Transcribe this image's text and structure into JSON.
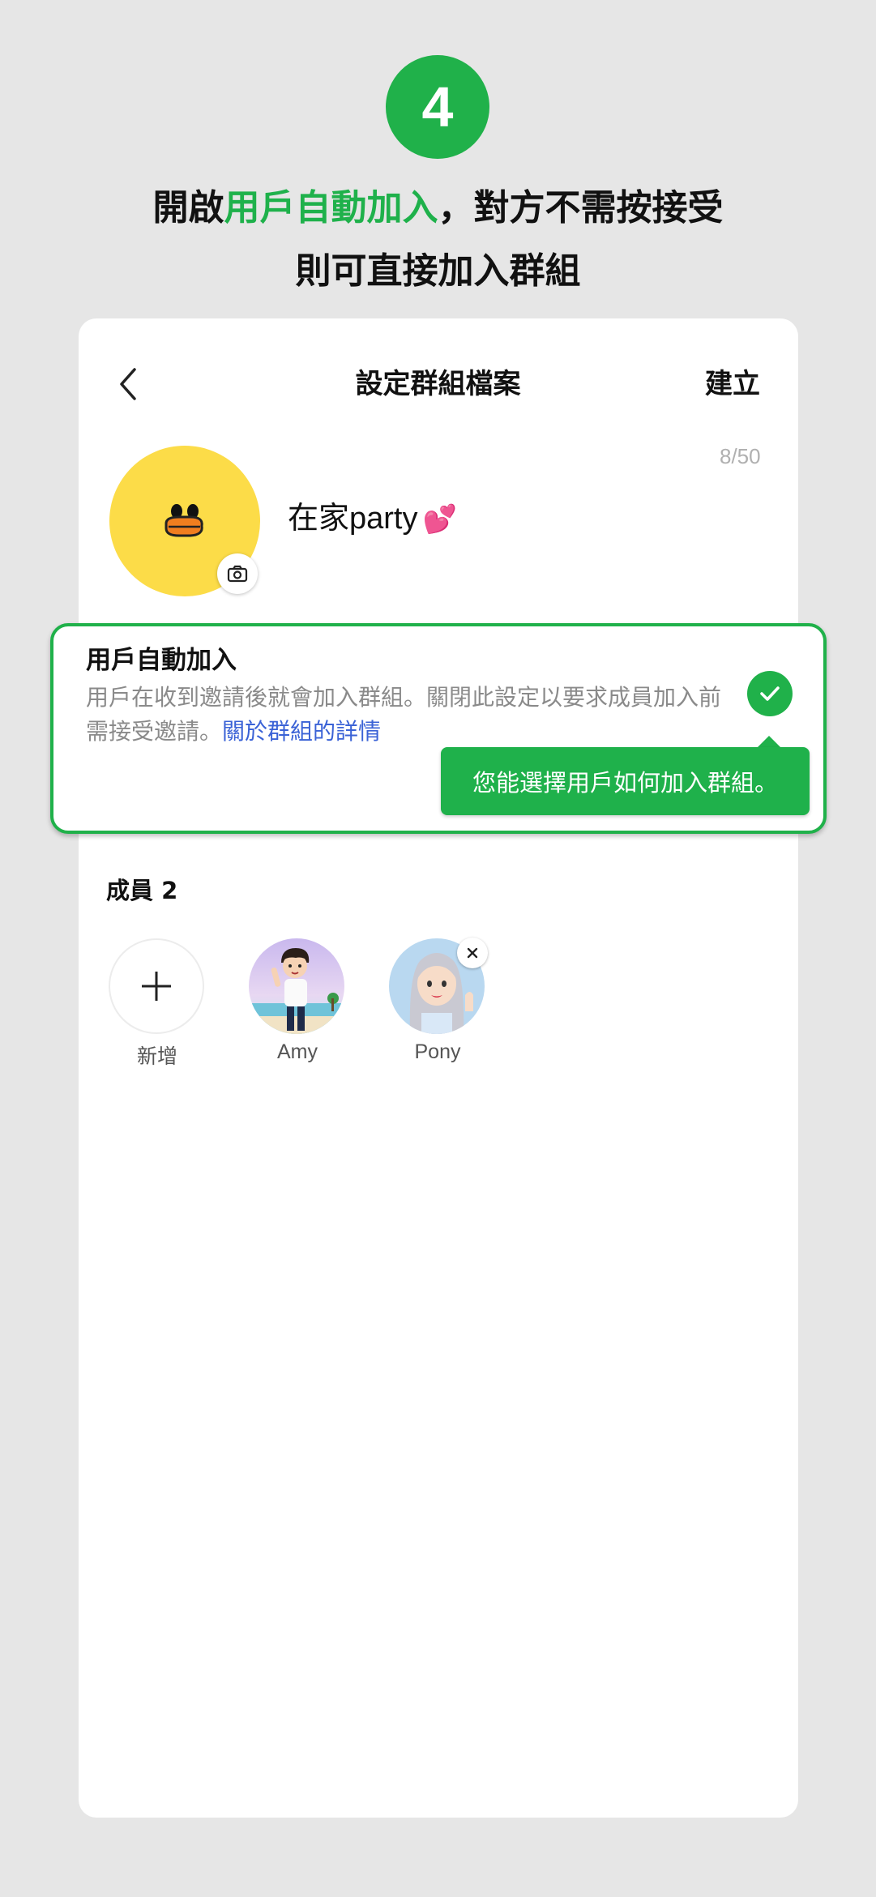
{
  "step": {
    "number": "4"
  },
  "headline": {
    "line1_pre": "開啟",
    "line1_highlight": "用戶自動加入",
    "line1_post": "，對方不需按接受",
    "line2": "則可直接加入群組"
  },
  "nav": {
    "title": "設定群組檔案",
    "create_label": "建立",
    "back_icon": "chevron-left-icon"
  },
  "group": {
    "name": "在家party",
    "emoji": "💕",
    "char_count": "8/50",
    "avatar_icon": "duck-face-icon",
    "camera_icon": "camera-icon"
  },
  "auto_join": {
    "title": "用戶自動加入",
    "description": "用戶在收到邀請後就會加入群組。關閉此設定以要求成員加入前需接受邀請。",
    "link": "關於群組的詳情",
    "enabled": true,
    "tooltip": "您能選擇用戶如何加入群組。"
  },
  "members": {
    "header": "成員 2",
    "add_label": "新增",
    "items": [
      {
        "name": "Amy"
      },
      {
        "name": "Pony"
      }
    ]
  },
  "colors": {
    "accent": "#1fb14b",
    "link": "#3a62d6",
    "background": "#e6e6e6",
    "avatar_yellow": "#fcdc48"
  }
}
